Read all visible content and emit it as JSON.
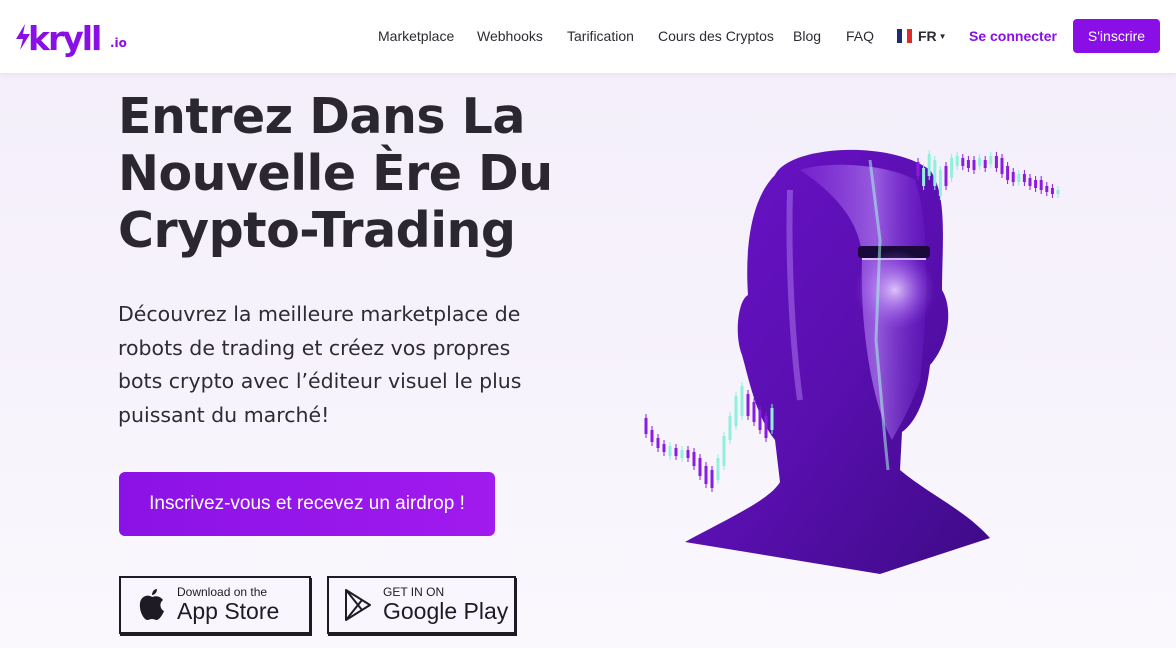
{
  "brand": {
    "logo_name": "kryll",
    "logo_tld": ".io"
  },
  "nav": {
    "links": [
      "Marketplace",
      "Webhooks",
      "Tarification",
      "Cours des Cryptos",
      "Blog",
      "FAQ"
    ],
    "language": "FR",
    "login_label": "Se connecter",
    "signup_label": "S'inscrire"
  },
  "hero": {
    "title_lines": [
      "Entrez Dans La",
      "Nouvelle Ère Du",
      "Crypto-Trading"
    ],
    "subtitle": "Découvrez la meilleure marketplace de robots de trading et créez vos propres bots crypto avec l’éditeur visuel le plus puissant du marché!",
    "cta_label": "Inscrivez-vous et recevez un airdrop !"
  },
  "stores": {
    "apple": {
      "small": "Download on the",
      "big": "App Store"
    },
    "google": {
      "small": "GET IN ON",
      "big": "Google Play"
    }
  },
  "colors": {
    "accent": "#8a0ee6",
    "text": "#2b2730",
    "candle_up": "#8ff0dc",
    "candle_down": "#8a1ce0"
  }
}
